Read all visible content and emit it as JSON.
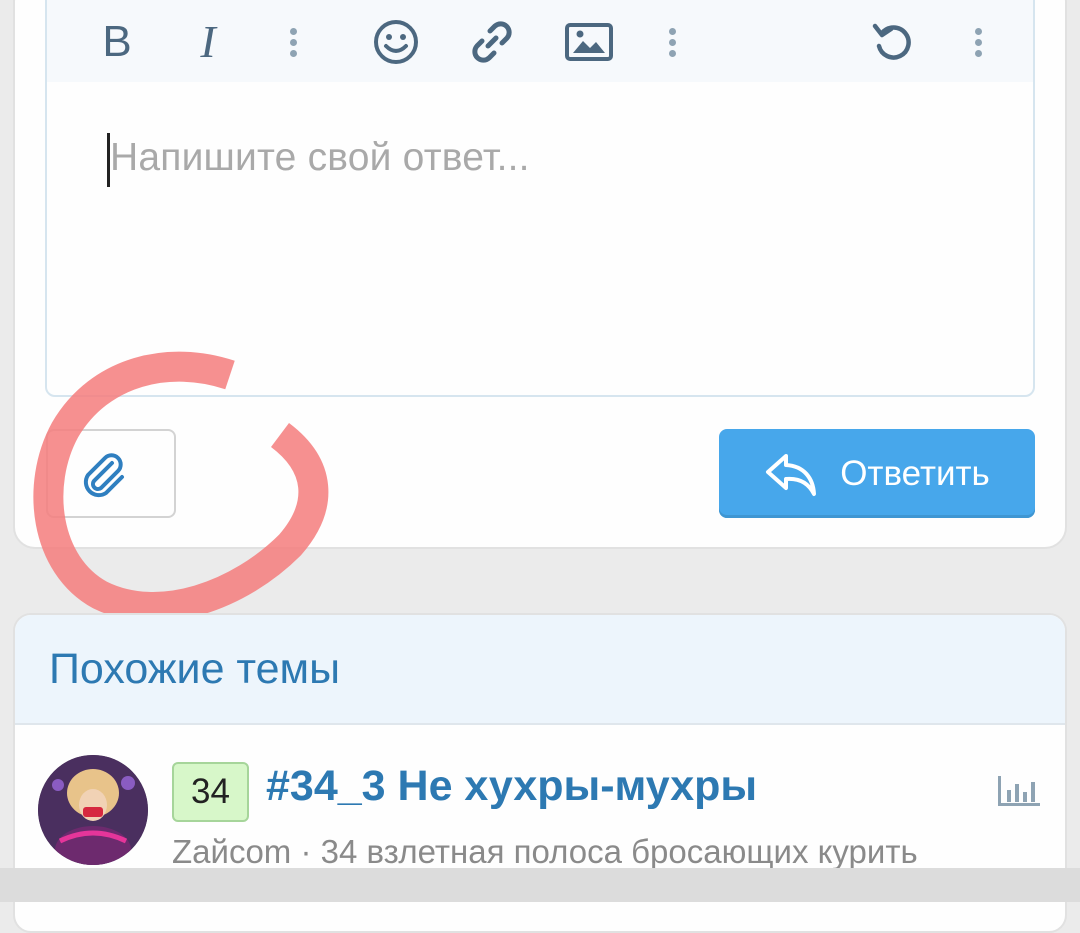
{
  "editor": {
    "toolbar": {
      "bold_label": "B",
      "italic_label": "I",
      "icons": [
        "bold-icon",
        "italic-icon",
        "more-dots-icon",
        "smiley-icon",
        "link-icon",
        "image-icon",
        "more-dots-icon",
        "undo-icon",
        "more-dots-icon"
      ]
    },
    "placeholder": "Напишите свой ответ..."
  },
  "actions": {
    "attach_icon": "paperclip-icon",
    "reply_label": "Ответить",
    "reply_icon": "reply-arrow-icon"
  },
  "similar": {
    "title": "Похожие темы",
    "threads": [
      {
        "badge": "34",
        "title": "#34_3 Не хухры-мухры",
        "meta": "Zaйcom · 34 взлетная полоса бросающих курить",
        "icon": "poll-icon"
      }
    ]
  },
  "colors": {
    "accent": "#47a7eb",
    "link": "#2d79b2",
    "badge_bg": "#d7f7c9",
    "highlight": "#f47c7c"
  }
}
